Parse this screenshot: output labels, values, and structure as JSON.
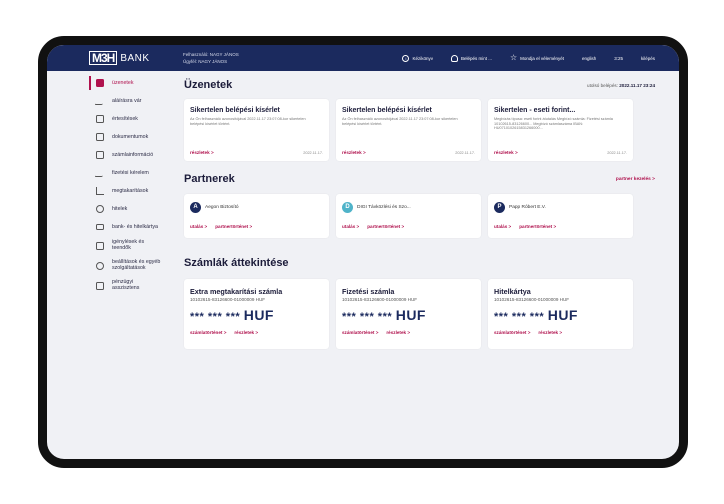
{
  "header": {
    "logo_mark": "M3H",
    "logo_text": "BANK",
    "user_line1": "Felhasználó: NAGY JÁNOS",
    "user_line2": "Ügyfél: NAGY JÁNOS",
    "actions": [
      {
        "label": "Kézikönyv",
        "icon": "info-icon"
      },
      {
        "label": "Belépés mint ...",
        "icon": "user-icon"
      },
      {
        "label": "Mondja el véleményét",
        "icon": "star-icon"
      }
    ],
    "language": "english",
    "timer": "3:25",
    "logout": "kilépés"
  },
  "sidebar": {
    "items": [
      {
        "label": "üzenetek",
        "icon": "envelope-icon",
        "active": true
      },
      {
        "label": "aláírásra vár",
        "icon": "pen-icon"
      },
      {
        "label": "értesítések",
        "icon": "alert-icon"
      },
      {
        "label": "dokumentumok",
        "icon": "document-icon"
      },
      {
        "label": "számlainformáció",
        "icon": "account-icon"
      },
      {
        "label": "fizetési kérelem",
        "icon": "pen-icon"
      },
      {
        "label": "megtakarítások",
        "icon": "chart-icon"
      },
      {
        "label": "hitelek",
        "icon": "loan-icon"
      },
      {
        "label": "bank- és hitelkártya",
        "icon": "card-icon"
      },
      {
        "label": "igénylések és teendők",
        "icon": "task-icon"
      },
      {
        "label": "beállítások és egyéb szolgáltatások",
        "icon": "gear-icon"
      },
      {
        "label": "pénzügyi asszisztens",
        "icon": "chat-icon"
      }
    ]
  },
  "messages": {
    "title": "Üzenetek",
    "updated_label": "utolsó belépés:",
    "updated_value": "2022.11.17 23:24",
    "cards": [
      {
        "title": "Sikertelen belépési kísérlet",
        "body": "Az Ön felhasználó azonosítójával 2022.11.17 23:07:08-kor sikertelen belépési kísérlet történt.",
        "link": "részletek >",
        "date": "2022.11.17."
      },
      {
        "title": "Sikertelen belépési kísérlet",
        "body": "Az Ön felhasználó azonosítójával 2022.11.17 23:07:08-kor sikertelen belépési kísérlet történt.",
        "link": "részletek >",
        "date": "2022.11.17."
      },
      {
        "title": "Sikertelen - eseti forint...",
        "body": "Megbízás típusa: eseti forint átutalás Megbízó számla: Fizetési számla 10102615-83126600... Megbízó számlaszáma IBAN: HU0710102615831266000...",
        "link": "részletek >",
        "date": "2022.11.17."
      }
    ]
  },
  "partners": {
    "title": "Partnerek",
    "manage_link": "partner kezelés >",
    "cards": [
      {
        "initial": "A",
        "name": "Aegon Biztosító",
        "color": "#1b2a5e",
        "link1": "utalás >",
        "link2": "partnertörténet >"
      },
      {
        "initial": "D",
        "name": "DIGI Távközlési és Szo...",
        "color": "#4fb3c9",
        "link1": "utalás >",
        "link2": "partnertörténet >"
      },
      {
        "initial": "P",
        "name": "Papp Róbert E.V.",
        "color": "#1b2a5e",
        "link1": "utalás >",
        "link2": "partnertörténet >"
      }
    ]
  },
  "accounts": {
    "title": "Számlák áttekintése",
    "cards": [
      {
        "title": "Extra megtakarítási számla",
        "number": "10102615-83126600-01000009 HUF",
        "balance": "*** *** ***",
        "currency": "HUF",
        "link1": "számlatörténet >",
        "link2": "részletek >"
      },
      {
        "title": "Fizetési számla",
        "number": "10102615-83126600-01000009 HUF",
        "balance": "*** *** ***",
        "currency": "HUF",
        "link1": "számlatörténet >",
        "link2": "részletek >"
      },
      {
        "title": "Hitelkártya",
        "number": "10102615-83126600-01000009 HUF",
        "balance": "*** *** ***",
        "currency": "HUF",
        "link1": "számlatörténet >",
        "link2": "részletek >"
      }
    ]
  },
  "colors": {
    "navy": "#1b2a5e",
    "accent": "#b0124e",
    "background": "#f0f1f5"
  }
}
